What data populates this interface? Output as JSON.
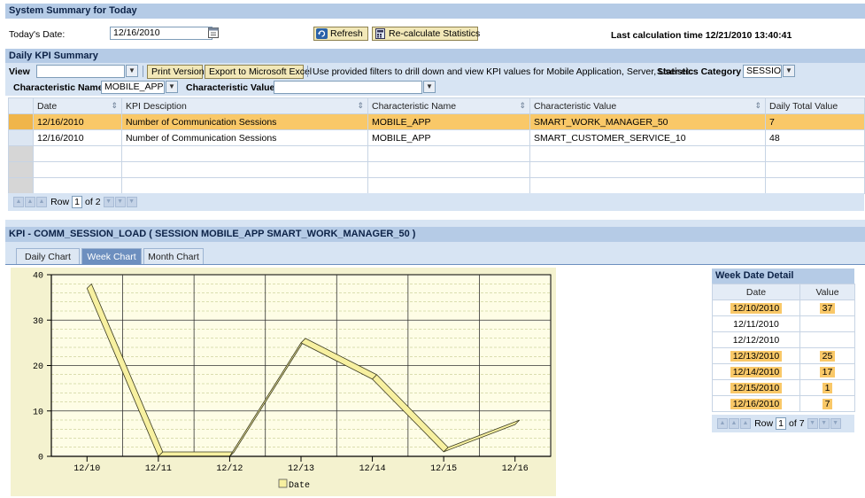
{
  "system_header": {
    "title": "System Summary for Today"
  },
  "toolbar": {
    "date_label": "Today's Date:",
    "date_value": "12/16/2010",
    "refresh_label": "Refresh",
    "recalc_label": "Re-calculate Statistics",
    "last_calc": "Last calculation time 12/21/2010 13:40:41"
  },
  "kpi_summary": {
    "title": "Daily KPI Summary",
    "view_label": "View",
    "view_value": "",
    "print_label": "Print Version",
    "export_label": "Export to Microsoft Excel",
    "hint": "Use provided filters to drill down and view KPI values for Mobile Application, Server, User etc",
    "stats_category_label": "Statistics Category",
    "stats_category_value": "SESSION",
    "char_name_label": "Characteristic Name",
    "char_name_value": "MOBILE_APP",
    "char_value_label": "Characteristic Value",
    "char_value_value": ""
  },
  "table": {
    "columns": [
      "Date",
      "KPI Desciption",
      "Characteristic Name",
      "Characteristic Value",
      "Daily Total Value"
    ],
    "rows": [
      {
        "date": "12/16/2010",
        "kpi": "Number of Communication Sessions",
        "cname": "MOBILE_APP",
        "cvalue": "SMART_WORK_MANAGER_50",
        "total": "7"
      },
      {
        "date": "12/16/2010",
        "kpi": "Number of Communication Sessions",
        "cname": "MOBILE_APP",
        "cvalue": "SMART_CUSTOMER_SERVICE_10",
        "total": "48"
      }
    ],
    "pager": {
      "row_label": "Row",
      "row_value": "1",
      "of_label": "of 2"
    }
  },
  "kpi_chart_header": {
    "title": "KPI - COMM_SESSION_LOAD ( SESSION MOBILE_APP SMART_WORK_MANAGER_50 )"
  },
  "tabs": {
    "daily": "Daily Chart",
    "week": "Week Chart",
    "month": "Month Chart"
  },
  "chart_data": {
    "type": "area",
    "categories": [
      "12/10",
      "12/11",
      "12/12",
      "12/13",
      "12/14",
      "12/15",
      "12/16"
    ],
    "series": [
      {
        "name": "Date",
        "values": [
          37,
          0,
          0,
          25,
          17,
          1,
          7
        ]
      }
    ],
    "ylim": [
      0,
      40
    ],
    "yticks": [
      "0",
      "10",
      "20",
      "30",
      "40"
    ],
    "legend": "Date",
    "legend_position": "bottom",
    "grid": true,
    "colors": {
      "series": "#f7f0a0",
      "plot_bg": "#fefde6",
      "frame": "#f4f2cf"
    }
  },
  "week_detail": {
    "title": "Week Date Detail",
    "col_date": "Date",
    "col_value": "Value",
    "rows": [
      {
        "date": "12/10/2010",
        "value": "37"
      },
      {
        "date": "12/11/2010",
        "value": ""
      },
      {
        "date": "12/12/2010",
        "value": ""
      },
      {
        "date": "12/13/2010",
        "value": "25"
      },
      {
        "date": "12/14/2010",
        "value": "17"
      },
      {
        "date": "12/15/2010",
        "value": "1"
      },
      {
        "date": "12/16/2010",
        "value": "7"
      }
    ],
    "pager": {
      "row_label": "Row",
      "row_value": "1",
      "of_label": "of 7"
    }
  },
  "icons": {
    "refresh": "refresh-icon",
    "calc": "calculator-icon",
    "calendar": "calendar-icon"
  },
  "colors": {
    "header": "#b5cbe6",
    "band": "#d7e4f3",
    "selected_row": "#f9c868",
    "active_tab": "#6d8fbf"
  }
}
